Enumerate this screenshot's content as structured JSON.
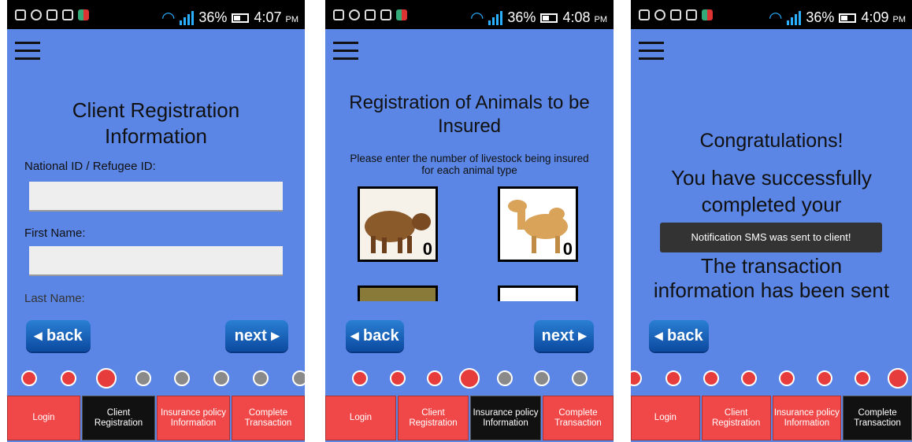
{
  "screens": [
    {
      "status": {
        "battery": "36%",
        "time": "4:07",
        "ampm": "PM"
      },
      "title_line1": "Client Registration",
      "title_line2": "Information",
      "fields": [
        {
          "label": "National ID / Refugee ID:",
          "value": ""
        },
        {
          "label": "First Name:",
          "value": ""
        },
        {
          "label": "Last Name:"
        }
      ],
      "back_label": "◂ back",
      "next_label": "next ▸",
      "tabs": [
        "Login",
        "Client Registration",
        "Insurance policy Information",
        "Complete Transaction"
      ]
    },
    {
      "status": {
        "battery": "36%",
        "time": "4:08",
        "ampm": "PM"
      },
      "title_line1": "Registration of Animals to be",
      "title_line2": "Insured",
      "instruction": "Please enter the number of livestock being insured for each animal type",
      "animals": [
        {
          "name": "cow",
          "count": "0"
        },
        {
          "name": "camel",
          "count": "0"
        }
      ],
      "back_label": "◂ back",
      "next_label": "next ▸",
      "tabs": [
        "Login",
        "Client Registration",
        "Insurance policy Information",
        "Complete Transaction"
      ]
    },
    {
      "status": {
        "battery": "36%",
        "time": "4:09",
        "ampm": "PM"
      },
      "congrats": "Congratulations!",
      "success_line1": "You have successfully",
      "success_line2": "completed your",
      "toast": "Notification SMS was sent to client!",
      "info_line1": "The transaction",
      "info_line2": "information has been sent",
      "back_label": "◂ back",
      "tabs": [
        "Login",
        "Client Registration",
        "Insurance policy Information",
        "Complete Transaction"
      ]
    }
  ],
  "colors": {
    "app_bg": "#5b86e5",
    "tab_red": "#f04848",
    "tab_active": "#111111",
    "button_blue": "#1760b8"
  }
}
